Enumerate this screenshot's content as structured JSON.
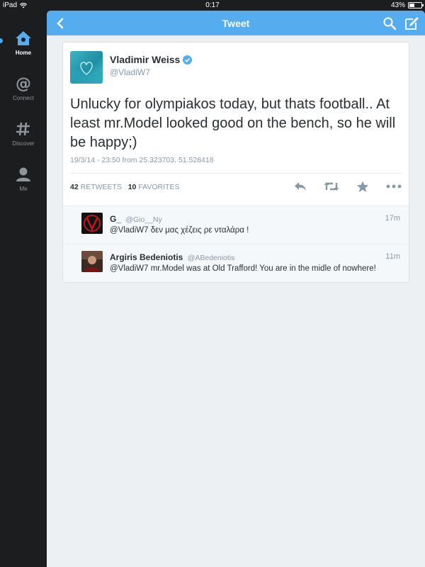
{
  "status_bar": {
    "device": "iPad",
    "time": "0:17",
    "battery": "43%",
    "battery_level": 0.43
  },
  "sidebar": {
    "items": [
      {
        "label": "Home",
        "icon": "home-icon",
        "active": true
      },
      {
        "label": "Connect",
        "icon": "at-icon",
        "active": false
      },
      {
        "label": "Discover",
        "icon": "hashtag-icon",
        "active": false
      },
      {
        "label": "Me",
        "icon": "person-icon",
        "active": false
      }
    ]
  },
  "header": {
    "title": "Tweet"
  },
  "tweet": {
    "author_name": "Vladimir Weiss",
    "author_handle": "@VladiW7",
    "verified": true,
    "text": "Unlucky for olympiakos today, but thats football.. At least mr.Model looked good on the bench, so he will be happy;)",
    "meta": "19/3/14 - 23:50 from 25.323703, 51.528418",
    "retweets_count": "42",
    "retweets_label": "RETWEETS",
    "favorites_count": "10",
    "favorites_label": "FAVORITES"
  },
  "replies": [
    {
      "name": "G_",
      "handle": "@Gio__Ny",
      "time": "17m",
      "text": "@VladiW7 δεν μας χέζεις ρε νταλάρα !"
    },
    {
      "name": "Argiris Bedeniotis",
      "handle": "@ABedeniotis",
      "time": "11m",
      "text": "@VladiW7 mr.Model was at Old Trafford! You are in the midle of nowhere!"
    }
  ],
  "colors": {
    "accent": "#55acee",
    "sidebar_bg": "#1c1d1f",
    "text": "#292f33",
    "muted": "#8899a6"
  }
}
